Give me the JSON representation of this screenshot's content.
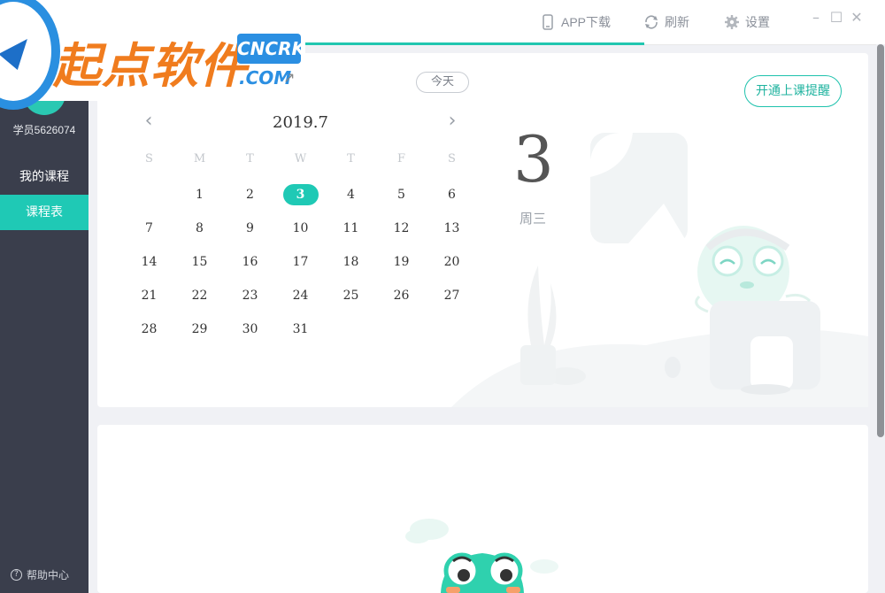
{
  "logo": {
    "name": "起点软件",
    "badge": "CNCRK",
    "domain": ".COM"
  },
  "topbar": {
    "app_download": "APP下载",
    "refresh": "刷新",
    "settings": "设置"
  },
  "sidebar": {
    "username": "学员5626074",
    "items": [
      {
        "label": "我的课程",
        "active": false
      },
      {
        "label": "课程表",
        "active": true
      }
    ],
    "help": "帮助中心"
  },
  "calendar": {
    "today_label": "今天",
    "remind_label": "开通上课提醒",
    "month_title": "2019.7",
    "weekdays": [
      "S",
      "M",
      "T",
      "W",
      "T",
      "F",
      "S"
    ],
    "days": [
      "1",
      "2",
      "3",
      "4",
      "5",
      "6",
      "7",
      "8",
      "9",
      "10",
      "11",
      "12",
      "13",
      "14",
      "15",
      "16",
      "17",
      "18",
      "19",
      "20",
      "21",
      "22",
      "23",
      "24",
      "25",
      "26",
      "27",
      "28",
      "29",
      "30",
      "31"
    ],
    "selected_day": "3",
    "big_date": "3",
    "big_weekday": "周三"
  },
  "colors": {
    "accent": "#1fc9b5",
    "sidebar": "#3a3e4c",
    "logo_orange": "#f07c1e",
    "logo_blue": "#2b8fe2"
  }
}
